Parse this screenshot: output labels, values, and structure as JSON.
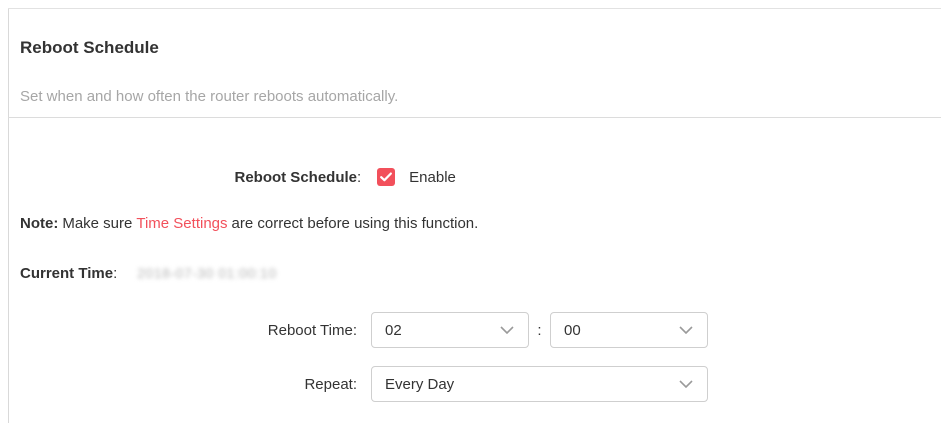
{
  "section": {
    "title": "Reboot Schedule",
    "description": "Set when and how often the router reboots automatically."
  },
  "reboot_schedule": {
    "label": "Reboot Schedule",
    "colon": ":",
    "enabled": true,
    "enable_label": "Enable"
  },
  "note": {
    "prefix": "Note:",
    "text_before": "Make sure",
    "link": "Time Settings",
    "text_after": "are correct before using this function."
  },
  "current_time": {
    "label": "Current Time",
    "colon": ":",
    "value": "2018-07-30 01:00:10"
  },
  "reboot_time": {
    "label": "Reboot Time:",
    "hour": "02",
    "separator": ":",
    "minute": "00"
  },
  "repeat": {
    "label": "Repeat:",
    "value": "Every Day"
  },
  "colors": {
    "accent": "#f2505b",
    "text": "#333333",
    "muted": "#a6a6a6",
    "border": "#cfcfcf"
  },
  "icons": {
    "checkbox": "checkmark-icon",
    "dropdown": "chevron-down-icon"
  }
}
